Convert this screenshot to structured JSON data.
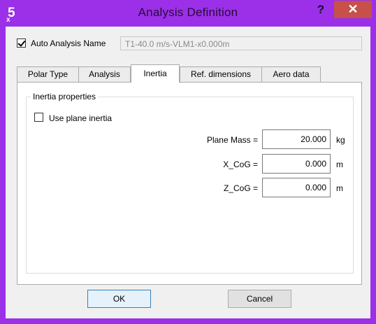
{
  "window": {
    "title": "Analysis Definition",
    "help": "?",
    "close": "✕"
  },
  "auto_name": {
    "label": "Auto Analysis Name",
    "checked": true,
    "value": "T1-40.0 m/s-VLM1-x0.000m"
  },
  "tabs": [
    {
      "label": "Polar Type",
      "active": false
    },
    {
      "label": "Analysis",
      "active": false
    },
    {
      "label": "Inertia",
      "active": true
    },
    {
      "label": "Ref. dimensions",
      "active": false
    },
    {
      "label": "Aero data",
      "active": false
    }
  ],
  "inertia": {
    "group_title": "Inertia properties",
    "use_plane_inertia": {
      "label": "Use plane inertia",
      "checked": false
    },
    "mass": {
      "label": "Plane Mass =",
      "value": "20.000",
      "unit": "kg"
    },
    "xcog": {
      "label": "X_CoG =",
      "value": "0.000",
      "unit": "m"
    },
    "zcog": {
      "label": "Z_CoG =",
      "value": "0.000",
      "unit": "m"
    }
  },
  "buttons": {
    "ok": "OK",
    "cancel": "Cancel"
  }
}
